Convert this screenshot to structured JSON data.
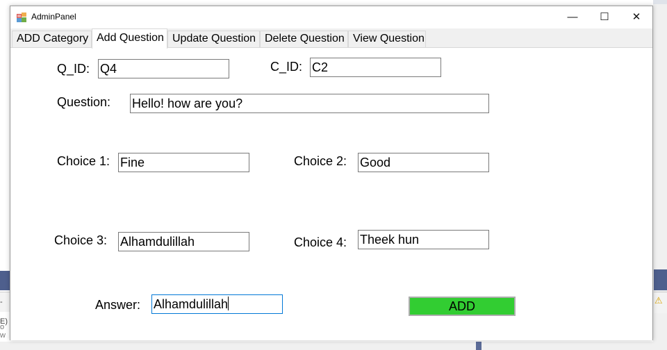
{
  "window": {
    "title": "AdminPanel",
    "controls": {
      "minimize": "—",
      "maximize": "☐",
      "close": "✕"
    }
  },
  "tabs": [
    {
      "label": "ADD Category"
    },
    {
      "label": "Add Question",
      "active": true
    },
    {
      "label": "Update Question"
    },
    {
      "label": "Delete Question"
    },
    {
      "label": "View Question"
    }
  ],
  "form": {
    "q_id": {
      "label": "Q_ID:",
      "value": "Q4"
    },
    "c_id": {
      "label": "C_ID:",
      "value": "C2"
    },
    "question": {
      "label": "Question:",
      "value": "Hello! how are you?"
    },
    "choice1": {
      "label": "Choice 1:",
      "value": "Fine"
    },
    "choice2": {
      "label": "Choice 2:",
      "value": "Good"
    },
    "choice3": {
      "label": "Choice 3:",
      "value": "Alhamdulillah"
    },
    "choice4": {
      "label": "Choice 4:",
      "value": "Theek hun"
    },
    "answer": {
      "label": "Answer:",
      "value": "Alhamdulillah"
    },
    "add_button": {
      "label": "ADD",
      "color": "#32cd32"
    }
  },
  "background": {
    "left_fragments": [
      "-E)",
      "o w"
    ],
    "warning_icon": "⚠"
  }
}
